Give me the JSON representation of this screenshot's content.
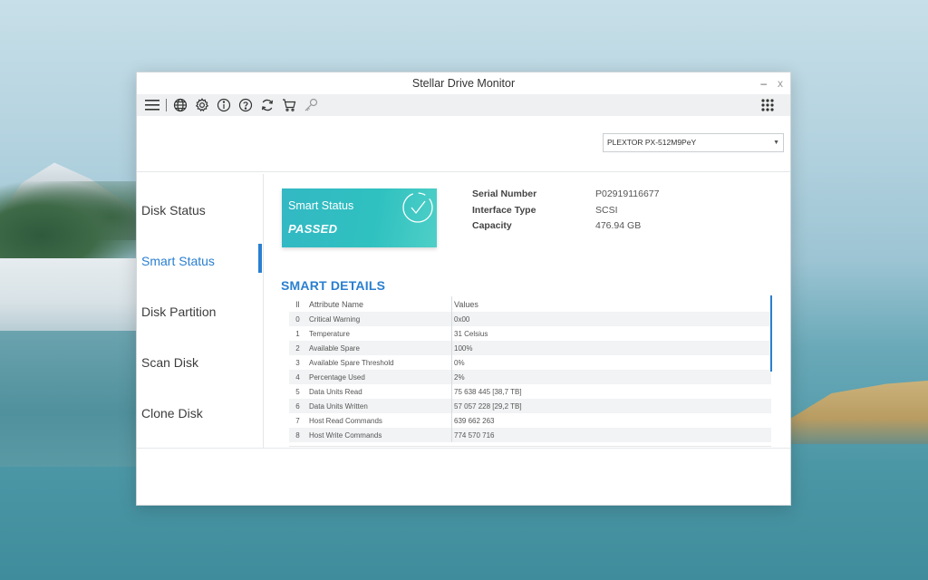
{
  "window": {
    "title": "Stellar Drive Monitor",
    "minimize_glyph": "–",
    "close_glyph": "x"
  },
  "toolbar": {
    "icons": [
      "menu-icon",
      "globe-icon",
      "gear-icon",
      "info-icon",
      "help-icon",
      "refresh-icon",
      "cart-icon",
      "key-icon",
      "apps-grid-icon"
    ]
  },
  "drive_select": {
    "value": "PLEXTOR PX-512M9PeY"
  },
  "sidebar": {
    "items": [
      {
        "label": "Disk Status"
      },
      {
        "label": "Smart Status"
      },
      {
        "label": "Disk Partition"
      },
      {
        "label": "Scan Disk"
      },
      {
        "label": "Clone Disk"
      }
    ],
    "active_index": 1
  },
  "smart_status": {
    "label": "Smart Status",
    "value": "PASSED"
  },
  "drive_info": {
    "serial_label": "Serial Number",
    "serial_value": "P02919116677",
    "interface_label": "Interface Type",
    "interface_value": "SCSI",
    "capacity_label": "Capacity",
    "capacity_value": "476.94 GB"
  },
  "smart_details": {
    "title": "SMART DETAILS",
    "headers": {
      "id": "ll",
      "name": "Attribute Name",
      "values": "Values"
    },
    "rows": [
      {
        "id": "0",
        "name": "Critical Warning",
        "value": "0x00"
      },
      {
        "id": "1",
        "name": "Temperature",
        "value": "31 Celsius"
      },
      {
        "id": "2",
        "name": "Available Spare",
        "value": "100%"
      },
      {
        "id": "3",
        "name": "Available Spare Threshold",
        "value": "0%"
      },
      {
        "id": "4",
        "name": "Percentage Used",
        "value": "2%"
      },
      {
        "id": "5",
        "name": "Data Units Read",
        "value": "75 638 445 [38,7 TB]"
      },
      {
        "id": "6",
        "name": "Data Units Written",
        "value": "57 057 228 [29,2 TB]"
      },
      {
        "id": "7",
        "name": "Host Read Commands",
        "value": "639 662 263"
      },
      {
        "id": "8",
        "name": "Host Write Commands",
        "value": "774 570 716"
      }
    ]
  },
  "colors": {
    "accent": "#2a7fd0",
    "status_card": "#2fc1c0"
  }
}
